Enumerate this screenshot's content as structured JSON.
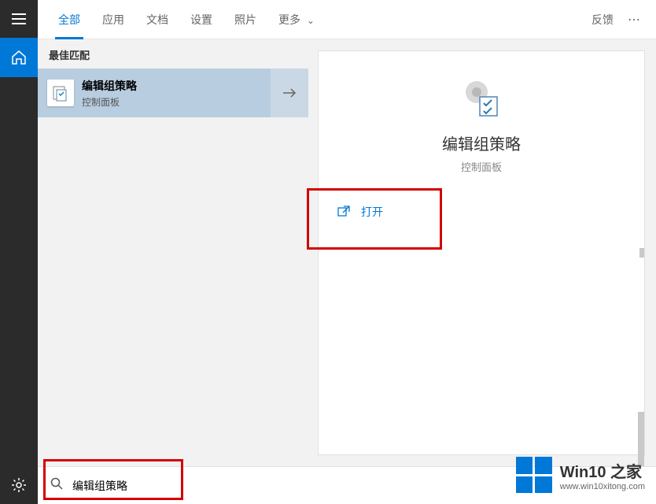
{
  "sidebar": {
    "menu": "menu",
    "home": "home",
    "settings": "settings"
  },
  "tabs": {
    "items": [
      {
        "label": "全部",
        "active": true
      },
      {
        "label": "应用"
      },
      {
        "label": "文档"
      },
      {
        "label": "设置"
      },
      {
        "label": "照片"
      },
      {
        "label": "更多",
        "chevron": true
      }
    ],
    "feedback": "反馈",
    "more": "⋯"
  },
  "left": {
    "section": "最佳匹配",
    "result": {
      "title": "编辑组策略",
      "subtitle": "控制面板"
    }
  },
  "detail": {
    "title": "编辑组策略",
    "subtitle": "控制面板",
    "actions": [
      {
        "label": "打开"
      }
    ]
  },
  "search": {
    "value": "编辑组策略",
    "placeholder": ""
  },
  "watermark": {
    "line1": "Win10 之家",
    "line2": "www.win10xitong.com"
  }
}
